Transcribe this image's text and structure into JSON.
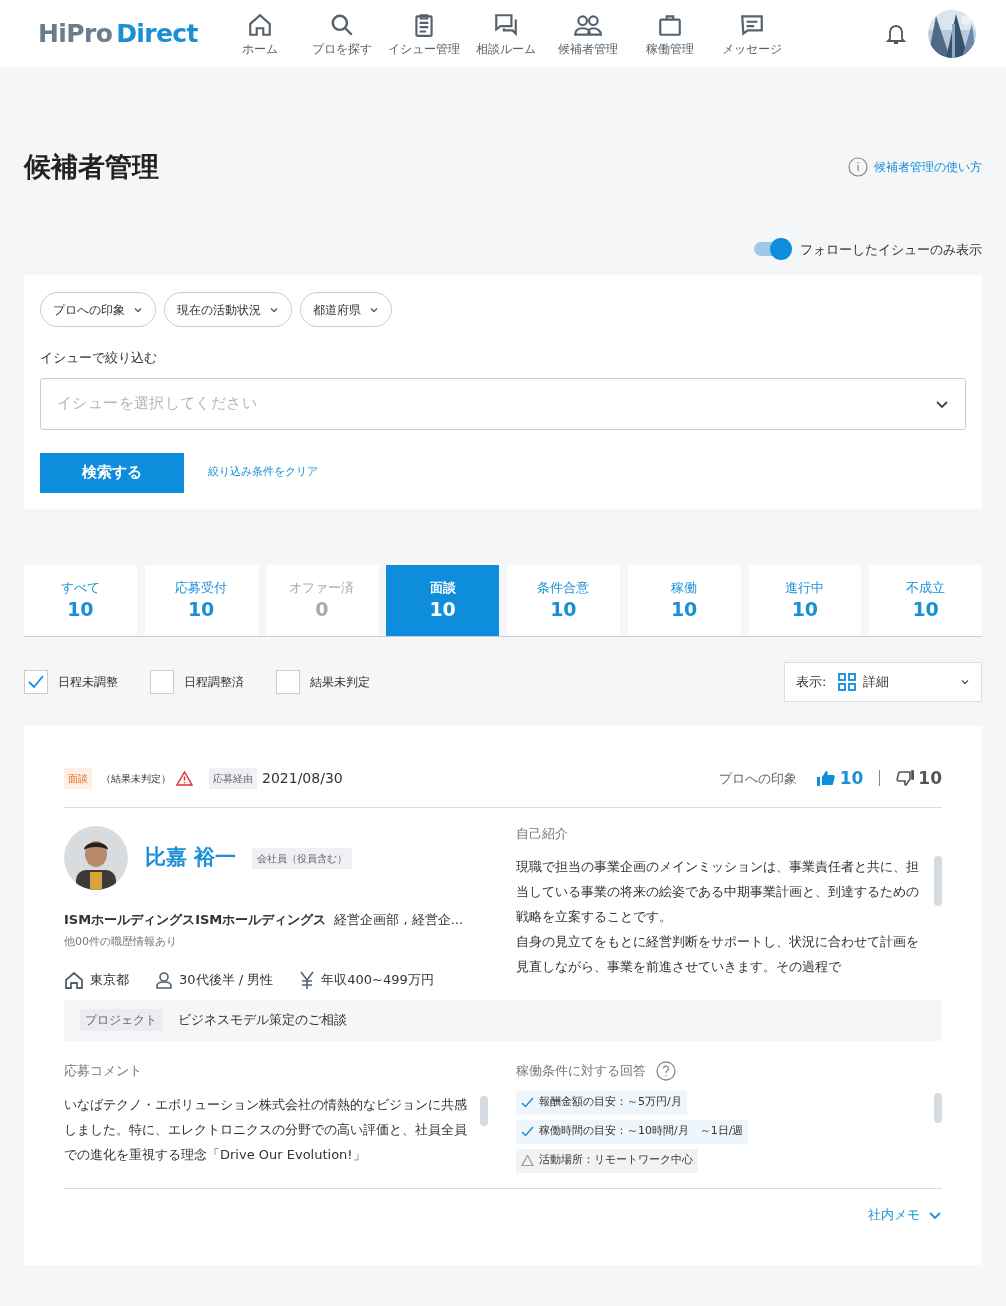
{
  "header": {
    "logo_prefix": "HiPro",
    "logo_suffix": "Direct",
    "nav": [
      {
        "label": "ホーム"
      },
      {
        "label": "プロを探す"
      },
      {
        "label": "イシュー管理"
      },
      {
        "label": "相談ルーム"
      },
      {
        "label": "候補者管理"
      },
      {
        "label": "稼働管理"
      },
      {
        "label": "メッセージ"
      }
    ]
  },
  "page": {
    "title": "候補者管理",
    "help_link": "候補者管理の使い方",
    "follow_toggle": {
      "label": "フォローしたイシューのみ表示",
      "on": true
    }
  },
  "filters": {
    "dropdowns": [
      "プロへの印象",
      "現在の活動状況",
      "都道府県"
    ],
    "issue_label": "イシューで絞り込む",
    "issue_select": {
      "placeholder": "イシューを選択してください"
    },
    "search_button": "検索する",
    "clear_link": "絞り込み条件をクリア"
  },
  "tabs": [
    {
      "label": "すべて",
      "count": "10",
      "selected": false,
      "disabled": false
    },
    {
      "label": "応募受付",
      "count": "10",
      "selected": false,
      "disabled": false
    },
    {
      "label": "オファー済",
      "count": "0",
      "selected": false,
      "disabled": true
    },
    {
      "label": "面談",
      "count": "10",
      "selected": true,
      "disabled": false
    },
    {
      "label": "条件合意",
      "count": "10",
      "selected": false,
      "disabled": false
    },
    {
      "label": "稼働",
      "count": "10",
      "selected": false,
      "disabled": false
    },
    {
      "label": "進行中",
      "count": "10",
      "selected": false,
      "disabled": false
    },
    {
      "label": "不成立",
      "count": "10",
      "selected": false,
      "disabled": false
    }
  ],
  "checkboxes": [
    {
      "label": "日程未調整",
      "checked": true
    },
    {
      "label": "日程調整済",
      "checked": false
    },
    {
      "label": "結果未判定",
      "checked": false
    }
  ],
  "view_select": {
    "label": "表示:",
    "value": "詳細"
  },
  "candidate": {
    "status_badge": "面談",
    "status_note": "（結果未判定）",
    "warning": true,
    "route_label": "応募経由",
    "date": "2021/08/30",
    "impression_label": "プロへの印象",
    "likes": "10",
    "dislikes": "10",
    "name": "比嘉 裕一",
    "employment": "会社員（役員含む）",
    "company": "ISMホールディングスISMホールディングス",
    "department": "経営企画部 , 経営企...",
    "career_note": "他00件の職歴情報あり",
    "location": "東京都",
    "age_gender": "30代後半 / 男性",
    "income": "年収400~499万円",
    "intro_label": "自己紹介",
    "intro_lines": [
      "現職で担当の事業企画のメインミッションは、事業責任者と共に、担当している事業の将来の絵姿である中期事業計画と、到達するための戦略を立案することです。",
      "自身の見立てをもとに経営判断をサポートし、状況に合わせて計画を見直しながら、事業を前進させていきます。その過程で"
    ],
    "project_label": "プロジェクト",
    "project": "ビジネスモデル策定のご相談",
    "comment_label": "応募コメント",
    "comment": "いなばテクノ・エボリューション株式会社の情熱的なビジョンに共感しました。特に、エレクトロニクスの分野での高い評価と、社員全員での進化を重視する理念「Drive Our Evolution!」",
    "conditions_label": "稼働条件に対する回答",
    "conditions": [
      {
        "text": "報酬金額の目安：～5万円/月",
        "kind": "match"
      },
      {
        "text": "稼働時間の目安：～10時間/月　～1日/週",
        "kind": "match"
      },
      {
        "text": "活動場所：リモートワーク中心",
        "kind": "partial"
      }
    ],
    "memo_link": "社内メモ"
  }
}
